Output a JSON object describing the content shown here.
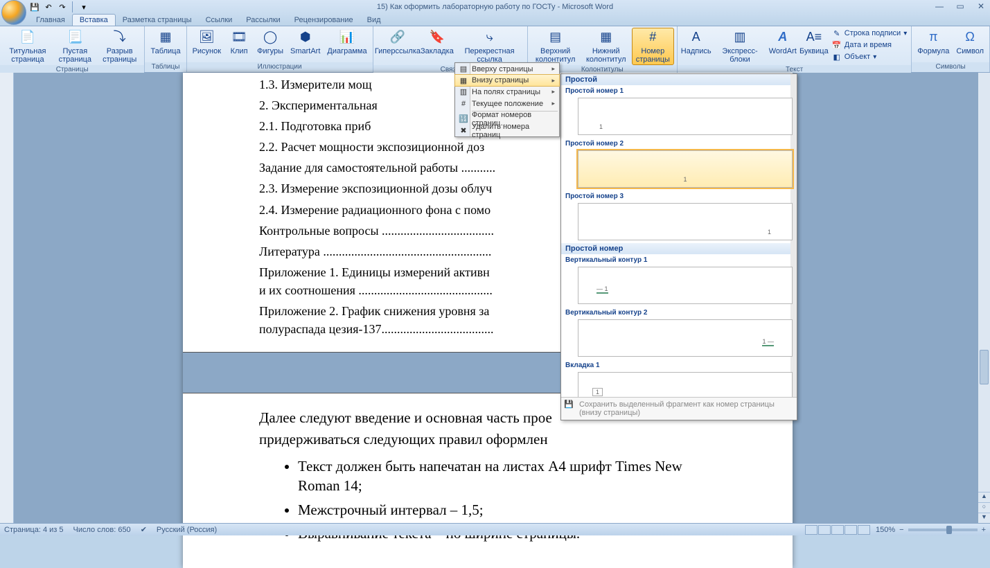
{
  "title": "15) Как оформить лабораторную работу по ГОСТу - Microsoft Word",
  "tabs": [
    "Главная",
    "Вставка",
    "Разметка страницы",
    "Ссылки",
    "Рассылки",
    "Рецензирование",
    "Вид"
  ],
  "active_tab": 1,
  "ribbon": {
    "pages": {
      "label": "Страницы",
      "btns": [
        "Титульная страница",
        "Пустая страница",
        "Разрыв страницы"
      ]
    },
    "tables": {
      "label": "Таблицы",
      "btns": [
        "Таблица"
      ]
    },
    "illus": {
      "label": "Иллюстрации",
      "btns": [
        "Рисунок",
        "Клип",
        "Фигуры",
        "SmartArt",
        "Диаграмма"
      ]
    },
    "links": {
      "label": "Связи",
      "btns": [
        "Гиперссылка",
        "Закладка",
        "Перекрестная ссылка"
      ]
    },
    "hf": {
      "label": "Колонтитулы",
      "btns": [
        "Верхний колонтитул",
        "Нижний колонтитул",
        "Номер страницы"
      ]
    },
    "text": {
      "label": "Текст",
      "btns": [
        "Надпись",
        "Экспресс-блоки",
        "WordArt",
        "Буквица"
      ],
      "rows": [
        "Строка подписи",
        "Дата и время",
        "Объект"
      ]
    },
    "symbols": {
      "label": "Символы",
      "btns": [
        "Формула",
        "Символ"
      ]
    }
  },
  "menu": {
    "items": [
      {
        "t": "Вверху страницы",
        "sub": true
      },
      {
        "t": "Внизу страницы",
        "sub": true,
        "hl": true
      },
      {
        "t": "На полях страницы",
        "sub": true
      },
      {
        "t": "Текущее положение",
        "sub": true
      },
      {
        "t": "Формат номеров страниц…"
      },
      {
        "t": "Удалить номера страниц"
      }
    ]
  },
  "gallery": {
    "head": "Простой",
    "items": [
      {
        "label": "Простой номер 1",
        "pos": "left"
      },
      {
        "label": "Простой номер 2",
        "pos": "center",
        "hov": true
      },
      {
        "label": "Простой номер 3",
        "pos": "right"
      }
    ],
    "head2": "Простой номер",
    "items2": [
      {
        "label": "Вертикальный контур 1",
        "pos": "left-box"
      },
      {
        "label": "Вертикальный контур 2",
        "pos": "right-box"
      }
    ],
    "head3_label": "Вкладка 1",
    "footer": "Сохранить выделенный фрагмент как номер страницы (внизу страницы)"
  },
  "doc": {
    "toc": [
      "1.3. Измерители мощ",
      "2. Экспериментальная",
      "2.1. Подготовка приб",
      "2.2. Расчет мощности экспозиционной доз",
      "Задание для самостоятельной работы ...........",
      "2.3. Измерение экспозиционной дозы облуч",
      "2.4. Измерение радиационного фона с помо",
      "Контрольные вопросы ....................................",
      "Литература ......................................................",
      "Приложение 1. Единицы измерений активн\nи их соотношения ...........................................",
      "Приложение 2. График снижения уровня за\nполураспада цезия-137...................................."
    ],
    "para": "Далее следуют введение и основная часть прое\nпридерживаться следующих правил оформлен",
    "bullets": [
      "Текст должен быть напечатан на листах А4 шрифт Times New Roman 14;",
      "Межстрочный интервал – 1,5;",
      "Выравнивание текста – по ширине страницы."
    ]
  },
  "status": {
    "page": "Страница: 4 из 5",
    "words": "Число слов: 650",
    "lang": "Русский (Россия)",
    "zoom": "150%"
  }
}
